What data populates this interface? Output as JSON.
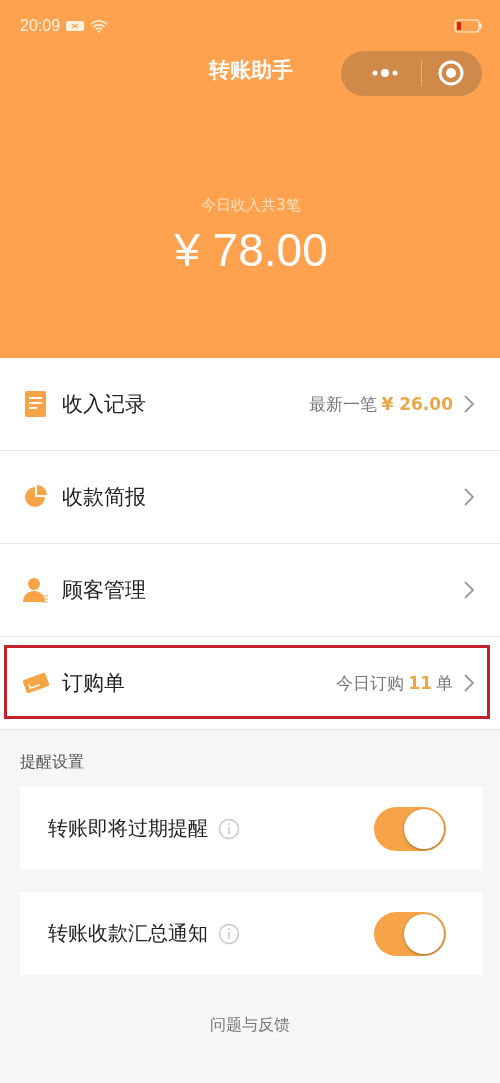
{
  "status_bar": {
    "time": "20:09"
  },
  "header": {
    "title": "转账助手",
    "summary": "今日收入共3笔",
    "amount": "¥ 78.00"
  },
  "menu": [
    {
      "label": "收入记录",
      "highlighted": false,
      "detail": [
        {
          "text": "最新一笔",
          "accent": false
        },
        {
          "text": "¥ 26.00",
          "accent": true
        }
      ]
    },
    {
      "label": "收款简报",
      "highlighted": false
    },
    {
      "label": "顾客管理",
      "highlighted": false
    },
    {
      "label": "订购单",
      "highlighted": true,
      "detail": [
        {
          "text": "今日订购",
          "accent": false
        },
        {
          "text": "11",
          "accent": true
        },
        {
          "text": "单",
          "accent": false
        }
      ]
    }
  ],
  "reminders": {
    "title": "提醒设置",
    "items": [
      {
        "label": "转账即将过期提醒",
        "on": true
      },
      {
        "label": "转账收款汇总通知",
        "on": true
      }
    ]
  },
  "footer": {
    "link": "问题与反馈"
  }
}
